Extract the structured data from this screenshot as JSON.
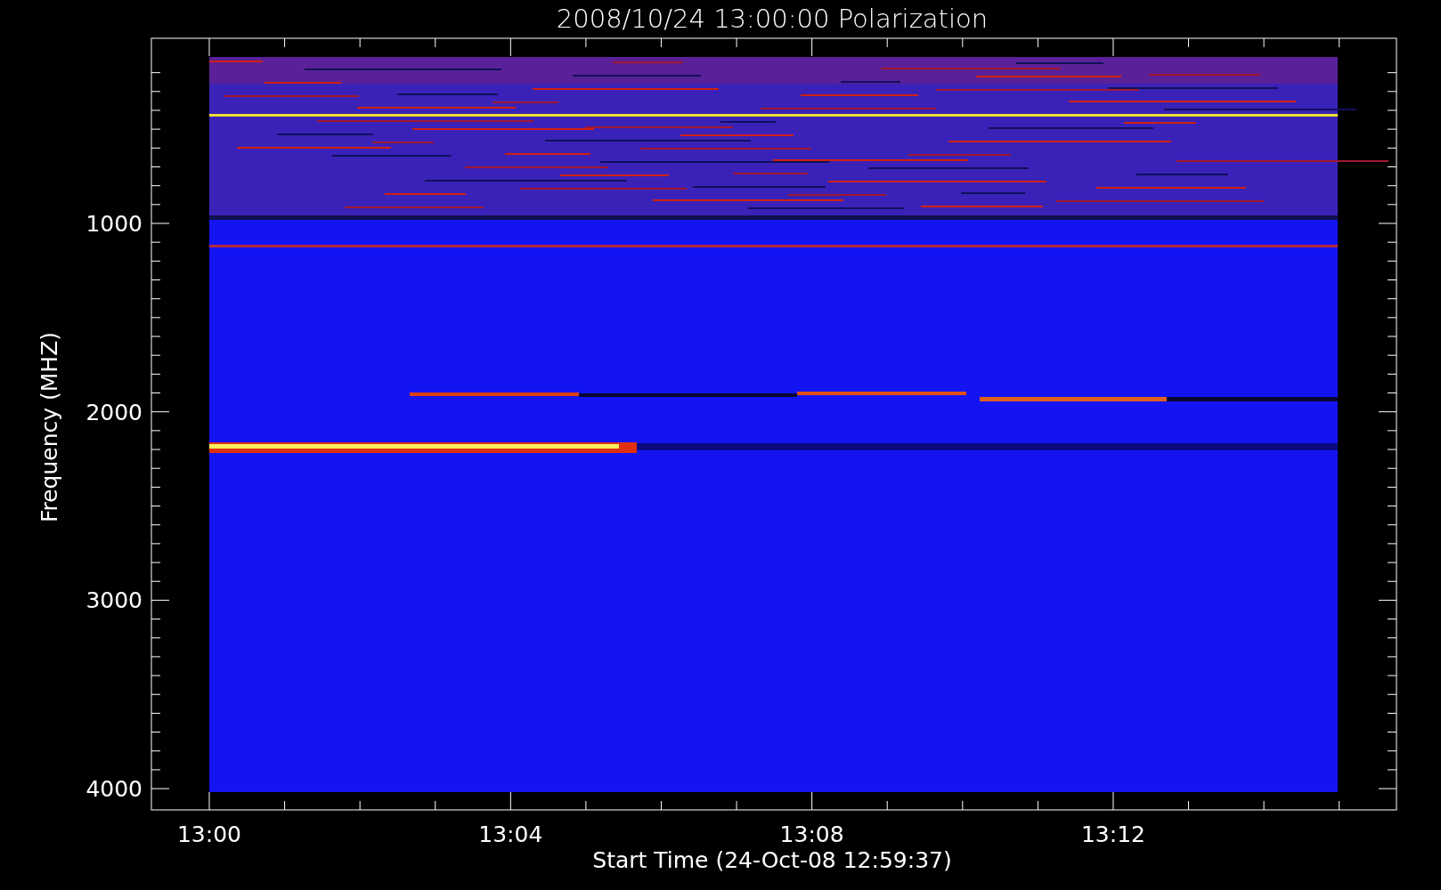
{
  "title": "2008/10/24 13:00:00 Polarization",
  "y_axis": {
    "label": "Frequency (MHZ)",
    "ticks": [
      "1000",
      "2000",
      "3000",
      "4000"
    ]
  },
  "x_axis": {
    "label": "Start Time (24-Oct-08 12:59:37)",
    "ticks": [
      "13:00",
      "13:04",
      "13:08",
      "13:12"
    ]
  }
}
